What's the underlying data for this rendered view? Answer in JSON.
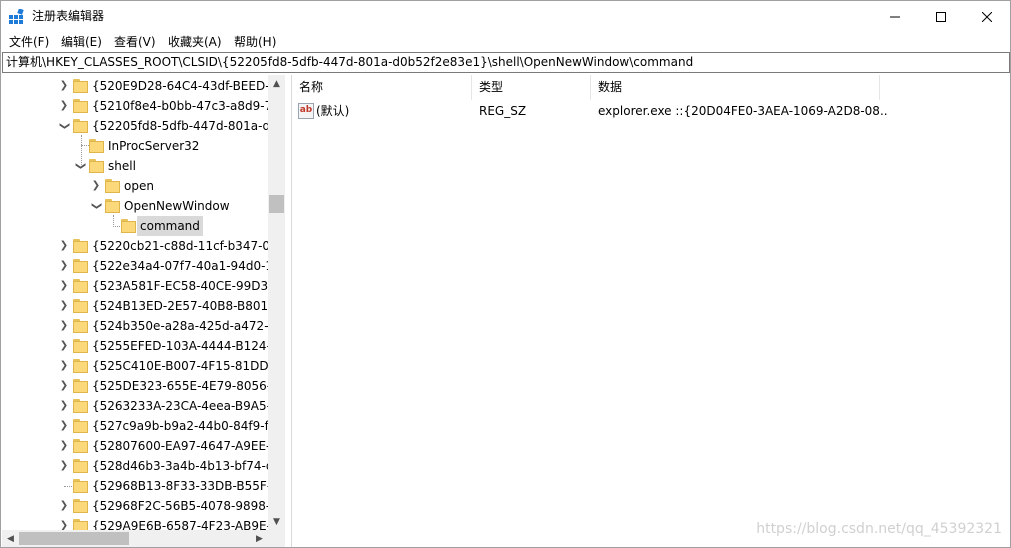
{
  "window": {
    "title": "注册表编辑器",
    "app_icon": "registry-editor-icon"
  },
  "menu": {
    "items": [
      "文件(F)",
      "编辑(E)",
      "查看(V)",
      "收藏夹(A)",
      "帮助(H)"
    ]
  },
  "address": {
    "path": "计算机\\HKEY_CLASSES_ROOT\\CLSID\\{52205fd8-5dfb-447d-801a-d0b52f2e83e1}\\shell\\OpenNewWindow\\command"
  },
  "tree": {
    "items": [
      {
        "label": "{520E9D28-64C4-43df-BEED-0",
        "expander": "collapsed"
      },
      {
        "label": "{5210f8e4-b0bb-47c3-a8d9-7b",
        "expander": "collapsed"
      },
      {
        "label": "{52205fd8-5dfb-447d-801a-d0",
        "expander": "expanded"
      },
      {
        "label": "InProcServer32",
        "expander": "none"
      },
      {
        "label": "shell",
        "expander": "expanded"
      },
      {
        "label": "open",
        "expander": "collapsed"
      },
      {
        "label": "OpenNewWindow",
        "expander": "expanded"
      },
      {
        "label": "command",
        "expander": "none",
        "selected": true
      },
      {
        "label": "{5220cb21-c88d-11cf-b347-00",
        "expander": "collapsed"
      },
      {
        "label": "{522e34a4-07f7-40a1-94d0-1b",
        "expander": "collapsed"
      },
      {
        "label": "{523A581F-EC58-40CE-99D3-3",
        "expander": "collapsed"
      },
      {
        "label": "{524B13ED-2E57-40B8-B801-5",
        "expander": "collapsed"
      },
      {
        "label": "{524b350e-a28a-425d-a472-c9",
        "expander": "collapsed"
      },
      {
        "label": "{5255EFED-103A-4444-B124-F8",
        "expander": "collapsed"
      },
      {
        "label": "{525C410E-B007-4F15-81DD-4",
        "expander": "collapsed"
      },
      {
        "label": "{525DE323-655E-4E79-8056-A",
        "expander": "collapsed"
      },
      {
        "label": "{5263233A-23CA-4eea-B9A5-2",
        "expander": "collapsed"
      },
      {
        "label": "{527c9a9b-b9a2-44b0-84f9-f0",
        "expander": "collapsed"
      },
      {
        "label": "{52807600-EA97-4647-A9EE-5E",
        "expander": "collapsed"
      },
      {
        "label": "{528d46b3-3a4b-4b13-bf74-d9",
        "expander": "collapsed"
      },
      {
        "label": "{52968B13-8F33-33DB-B55F-EE",
        "expander": "none"
      },
      {
        "label": "{52968F2C-56B5-4078-9898-EA",
        "expander": "collapsed"
      },
      {
        "label": "{529A9E6B-6587-4F23-AB9E-9C",
        "expander": "collapsed"
      }
    ]
  },
  "list": {
    "columns": [
      "名称",
      "类型",
      "数据"
    ],
    "rows": [
      {
        "name": "(默认)",
        "type": "REG_SZ",
        "data": "explorer.exe ::{20D04FE0-3AEA-1069-A2D8-08...",
        "icon": "string-value-icon"
      }
    ]
  },
  "watermark": "https://blog.csdn.net/qq_45392321",
  "colors": {
    "folder": "#fbd87a",
    "selection": "#d9d9d9",
    "app_icon_blue": "#1e7bd8"
  }
}
